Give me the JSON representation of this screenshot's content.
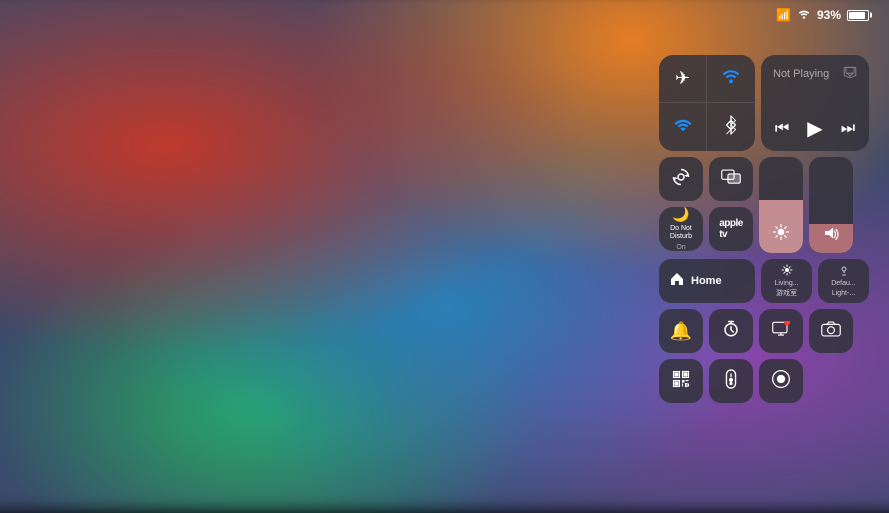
{
  "statusBar": {
    "battery": "93%",
    "wifiIcon": "wifi",
    "signalIcon": "signal"
  },
  "controlCenter": {
    "nowPlaying": {
      "title": "Not Playing",
      "prevIcon": "⏮",
      "playIcon": "▶",
      "nextIcon": "⏭",
      "airplayIcon": "⬡"
    },
    "connectivity": {
      "airplane": "✈",
      "cellular": "◎",
      "wifi": "wifi",
      "bluetooth": "bluetooth"
    },
    "screenLock": "🔒",
    "mirroring": "⧉",
    "brightness": {
      "icon": "☀",
      "fillPercent": 55
    },
    "volume": {
      "icon": "🔊",
      "fillPercent": 30
    },
    "dnd": {
      "icon": "🌙",
      "label": "Do Not\nDisturb",
      "sublabel": "On"
    },
    "appletv": "tv",
    "home": {
      "icon": "⌂",
      "label": "Home"
    },
    "scenes": [
      {
        "icon": "☰",
        "label": "Living...\n游戏室"
      },
      {
        "icon": "💡",
        "label": "Defau...\nLight-..."
      }
    ],
    "bottomRow1": [
      {
        "icon": "🔔",
        "name": "alarm-button"
      },
      {
        "icon": "⏱",
        "name": "timer-button"
      },
      {
        "icon": "📺",
        "name": "screen-record-button"
      },
      {
        "icon": "📷",
        "name": "camera-button"
      }
    ],
    "bottomRow2": [
      {
        "icon": "⊞",
        "name": "qr-scanner-button"
      },
      {
        "icon": "🎛",
        "name": "remote-button"
      },
      {
        "icon": "⊙",
        "name": "record-button"
      }
    ]
  }
}
